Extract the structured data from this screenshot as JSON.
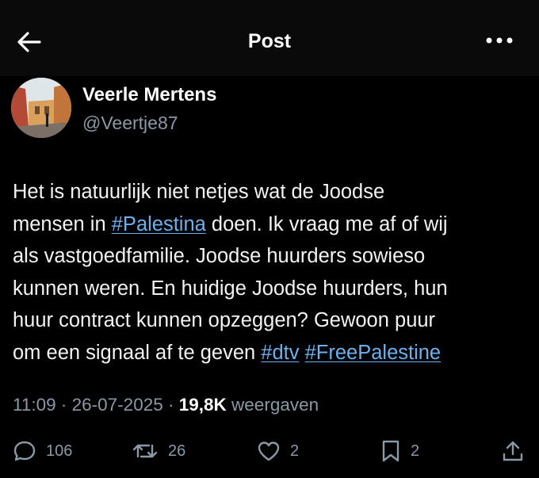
{
  "header": {
    "title": "Post",
    "back_icon": "arrow-left-icon",
    "more_icon": "more-horizontal-icon"
  },
  "author": {
    "name": "Veerle Mertens",
    "handle": "@Veertje87",
    "avatar_icon": "profile-photo"
  },
  "tweet": {
    "lines": [
      [
        "Het is natuurlijk niet netjes wat de Joodse"
      ],
      [
        "mensen in ",
        "#Palestina",
        " doen. Ik vraag me af of wij"
      ],
      [
        "als vastgoedfamilie. Joodse huurders sowieso"
      ],
      [
        "kunnen weren. En huidige Joodse huurders, hun"
      ],
      [
        "huur contract kunnen opzeggen? Gewoon puur"
      ],
      [
        "om een signaal af te geven ",
        "#dtv",
        " ",
        "#FreePalestine"
      ]
    ]
  },
  "meta": {
    "time": "11:09",
    "separator": " · ",
    "date": "26-07-2025",
    "views_count": "19,8K",
    "views_label": "weergaven"
  },
  "actions": {
    "replies": "106",
    "reposts": "26",
    "likes": "2",
    "bookmarks": "2"
  },
  "colors": {
    "background": "#000000",
    "text": "#e7e9ea",
    "secondary": "#8b98a5",
    "link": "#6ab1f0"
  }
}
